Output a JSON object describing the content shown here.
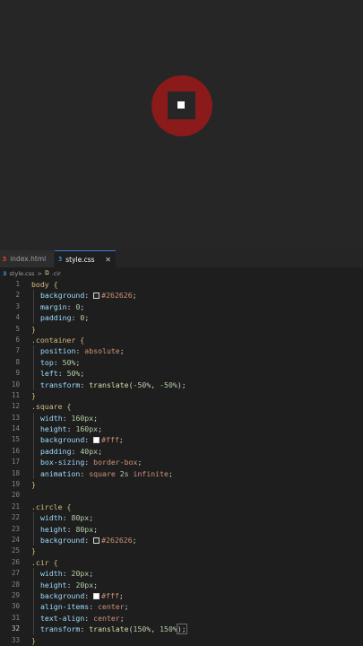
{
  "preview": {
    "background": "#262626",
    "circle_color": "#8b1a1a",
    "square_color": "#262626",
    "dot_color": "#ffffff"
  },
  "tabs": [
    {
      "icon": "html-file-icon",
      "icon_glyph": "5",
      "label": "index.html",
      "active": false
    },
    {
      "icon": "css-file-icon",
      "icon_glyph": "3",
      "label": "style.css",
      "active": true,
      "close": "✕"
    }
  ],
  "breadcrumb": {
    "file_glyph": "3",
    "file": "style.css",
    "sep": ">",
    "symbol_glyph": "⧉",
    "symbol": ".cir"
  },
  "code": [
    {
      "n": "1",
      "tokens": [
        {
          "c": "sel",
          "t": "body "
        },
        {
          "c": "brace",
          "t": "{"
        }
      ]
    },
    {
      "n": "2",
      "indent": true,
      "tokens": [
        {
          "c": "prop",
          "t": "background"
        },
        {
          "c": "punc",
          "t": ": "
        },
        {
          "swatch": "#262626"
        },
        {
          "c": "str",
          "t": "#262626"
        },
        {
          "c": "punc",
          "t": ";"
        }
      ]
    },
    {
      "n": "3",
      "indent": true,
      "tokens": [
        {
          "c": "prop",
          "t": "margin"
        },
        {
          "c": "punc",
          "t": ": "
        },
        {
          "c": "num",
          "t": "0"
        },
        {
          "c": "punc",
          "t": ";"
        }
      ]
    },
    {
      "n": "4",
      "indent": true,
      "tokens": [
        {
          "c": "prop",
          "t": "padding"
        },
        {
          "c": "punc",
          "t": ": "
        },
        {
          "c": "num",
          "t": "0"
        },
        {
          "c": "punc",
          "t": ";"
        }
      ]
    },
    {
      "n": "5",
      "tokens": [
        {
          "c": "brace",
          "t": "}"
        }
      ]
    },
    {
      "n": "6",
      "tokens": [
        {
          "c": "sel",
          "t": ".container "
        },
        {
          "c": "brace",
          "t": "{"
        }
      ]
    },
    {
      "n": "7",
      "indent": true,
      "tokens": [
        {
          "c": "prop",
          "t": "position"
        },
        {
          "c": "punc",
          "t": ": "
        },
        {
          "c": "str",
          "t": "absolute"
        },
        {
          "c": "punc",
          "t": ";"
        }
      ]
    },
    {
      "n": "8",
      "indent": true,
      "tokens": [
        {
          "c": "prop",
          "t": "top"
        },
        {
          "c": "punc",
          "t": ": "
        },
        {
          "c": "num",
          "t": "50%"
        },
        {
          "c": "punc",
          "t": ";"
        }
      ]
    },
    {
      "n": "9",
      "indent": true,
      "tokens": [
        {
          "c": "prop",
          "t": "left"
        },
        {
          "c": "punc",
          "t": ": "
        },
        {
          "c": "num",
          "t": "50%"
        },
        {
          "c": "punc",
          "t": ";"
        }
      ]
    },
    {
      "n": "10",
      "indent": true,
      "tokens": [
        {
          "c": "prop",
          "t": "transform"
        },
        {
          "c": "punc",
          "t": ": "
        },
        {
          "c": "fn",
          "t": "translate"
        },
        {
          "c": "punc",
          "t": "("
        },
        {
          "c": "num",
          "t": "-50%"
        },
        {
          "c": "punc",
          "t": ", "
        },
        {
          "c": "num",
          "t": "-50%"
        },
        {
          "c": "punc",
          "t": ");"
        }
      ]
    },
    {
      "n": "11",
      "tokens": [
        {
          "c": "brace",
          "t": "}"
        }
      ]
    },
    {
      "n": "12",
      "tokens": [
        {
          "c": "sel",
          "t": ".square "
        },
        {
          "c": "brace",
          "t": "{"
        }
      ]
    },
    {
      "n": "13",
      "indent": true,
      "tokens": [
        {
          "c": "prop",
          "t": "width"
        },
        {
          "c": "punc",
          "t": ": "
        },
        {
          "c": "num",
          "t": "160px"
        },
        {
          "c": "punc",
          "t": ";"
        }
      ]
    },
    {
      "n": "14",
      "indent": true,
      "tokens": [
        {
          "c": "prop",
          "t": "height"
        },
        {
          "c": "punc",
          "t": ": "
        },
        {
          "c": "num",
          "t": "160px"
        },
        {
          "c": "punc",
          "t": ";"
        }
      ]
    },
    {
      "n": "15",
      "indent": true,
      "tokens": [
        {
          "c": "prop",
          "t": "background"
        },
        {
          "c": "punc",
          "t": ": "
        },
        {
          "swatch": "#ffffff"
        },
        {
          "c": "str",
          "t": "#fff"
        },
        {
          "c": "punc",
          "t": ";"
        }
      ]
    },
    {
      "n": "16",
      "indent": true,
      "tokens": [
        {
          "c": "prop",
          "t": "padding"
        },
        {
          "c": "punc",
          "t": ": "
        },
        {
          "c": "num",
          "t": "40px"
        },
        {
          "c": "punc",
          "t": ";"
        }
      ]
    },
    {
      "n": "17",
      "indent": true,
      "tokens": [
        {
          "c": "prop",
          "t": "box-sizing"
        },
        {
          "c": "punc",
          "t": ": "
        },
        {
          "c": "str",
          "t": "border-box"
        },
        {
          "c": "punc",
          "t": ";"
        }
      ]
    },
    {
      "n": "18",
      "indent": true,
      "tokens": [
        {
          "c": "prop",
          "t": "animation"
        },
        {
          "c": "punc",
          "t": ": "
        },
        {
          "c": "str",
          "t": "square "
        },
        {
          "c": "num",
          "t": "2s"
        },
        {
          "c": "str",
          "t": " infinite"
        },
        {
          "c": "punc",
          "t": ";"
        }
      ]
    },
    {
      "n": "19",
      "tokens": [
        {
          "c": "brace",
          "t": "}"
        }
      ]
    },
    {
      "n": "20",
      "tokens": []
    },
    {
      "n": "21",
      "tokens": [
        {
          "c": "sel",
          "t": ".circle "
        },
        {
          "c": "brace",
          "t": "{"
        }
      ]
    },
    {
      "n": "22",
      "indent": true,
      "tokens": [
        {
          "c": "prop",
          "t": "width"
        },
        {
          "c": "punc",
          "t": ": "
        },
        {
          "c": "num",
          "t": "80px"
        },
        {
          "c": "punc",
          "t": ";"
        }
      ]
    },
    {
      "n": "23",
      "indent": true,
      "tokens": [
        {
          "c": "prop",
          "t": "height"
        },
        {
          "c": "punc",
          "t": ": "
        },
        {
          "c": "num",
          "t": "80px"
        },
        {
          "c": "punc",
          "t": ";"
        }
      ]
    },
    {
      "n": "24",
      "indent": true,
      "tokens": [
        {
          "c": "prop",
          "t": "background"
        },
        {
          "c": "punc",
          "t": ": "
        },
        {
          "swatch": "#262626"
        },
        {
          "c": "str",
          "t": "#262626"
        },
        {
          "c": "punc",
          "t": ";"
        }
      ]
    },
    {
      "n": "25",
      "tokens": [
        {
          "c": "brace",
          "t": "}"
        }
      ]
    },
    {
      "n": "26",
      "tokens": [
        {
          "c": "sel",
          "t": ".cir "
        },
        {
          "c": "brace",
          "t": "{"
        }
      ]
    },
    {
      "n": "27",
      "indent": true,
      "tokens": [
        {
          "c": "prop",
          "t": "width"
        },
        {
          "c": "punc",
          "t": ": "
        },
        {
          "c": "num",
          "t": "20px"
        },
        {
          "c": "punc",
          "t": ";"
        }
      ]
    },
    {
      "n": "28",
      "indent": true,
      "tokens": [
        {
          "c": "prop",
          "t": "height"
        },
        {
          "c": "punc",
          "t": ": "
        },
        {
          "c": "num",
          "t": "20px"
        },
        {
          "c": "punc",
          "t": ";"
        }
      ]
    },
    {
      "n": "29",
      "indent": true,
      "tokens": [
        {
          "c": "prop",
          "t": "background"
        },
        {
          "c": "punc",
          "t": ": "
        },
        {
          "swatch": "#ffffff"
        },
        {
          "c": "str",
          "t": "#fff"
        },
        {
          "c": "punc",
          "t": ";"
        }
      ]
    },
    {
      "n": "30",
      "indent": true,
      "tokens": [
        {
          "c": "prop",
          "t": "align-items"
        },
        {
          "c": "punc",
          "t": ": "
        },
        {
          "c": "str",
          "t": "center"
        },
        {
          "c": "punc",
          "t": ";"
        }
      ]
    },
    {
      "n": "31",
      "indent": true,
      "tokens": [
        {
          "c": "prop",
          "t": "text-align"
        },
        {
          "c": "punc",
          "t": ": "
        },
        {
          "c": "str",
          "t": "center"
        },
        {
          "c": "punc",
          "t": ";"
        }
      ]
    },
    {
      "n": "32",
      "indent": true,
      "active": true,
      "tokens": [
        {
          "c": "prop",
          "t": "transform"
        },
        {
          "c": "punc",
          "t": ": "
        },
        {
          "c": "fn",
          "t": "translate"
        },
        {
          "c": "punc",
          "t": "("
        },
        {
          "c": "num",
          "t": "150%"
        },
        {
          "c": "punc",
          "t": ", "
        },
        {
          "c": "num",
          "t": "150%"
        },
        {
          "c": "punc",
          "t": ");"
        }
      ]
    },
    {
      "n": "33",
      "tokens": [
        {
          "c": "brace",
          "t": "}"
        }
      ]
    }
  ]
}
